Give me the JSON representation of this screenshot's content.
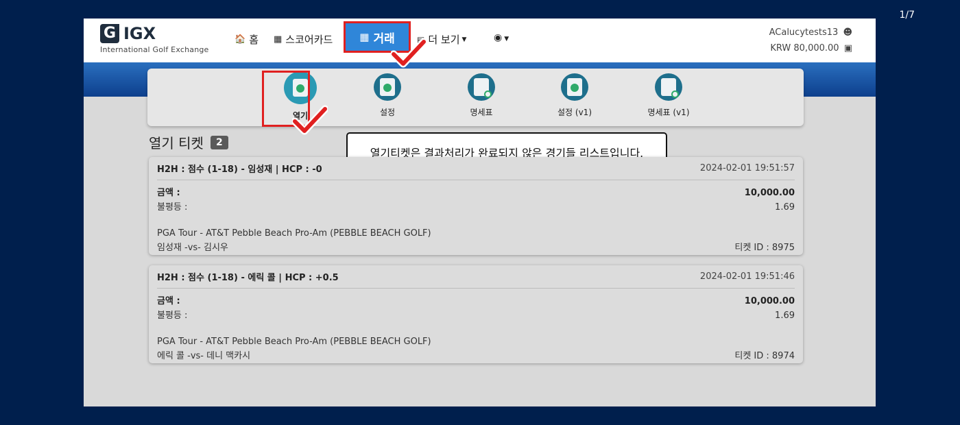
{
  "page_counter": "1/7",
  "brand": {
    "name": "IGX",
    "mark": "G",
    "subtitle": "International Golf Exchange"
  },
  "nav": {
    "home": "홈",
    "scorecard": "스코어카드",
    "trade": "거래",
    "more": "더 보기"
  },
  "user": {
    "name": "ACalucytests13",
    "balance": "KRW 80,000.00"
  },
  "tabs": [
    {
      "label": "열기"
    },
    {
      "label": "설정"
    },
    {
      "label": "명세표"
    },
    {
      "label": "설정 (v1)"
    },
    {
      "label": "명세표 (v1)"
    }
  ],
  "section": {
    "title": "열기 티켓",
    "count": "2"
  },
  "tooltip": "열기티켓은 결과처리가 완료되지 않은 경기들 리스트입니다.",
  "tickets": [
    {
      "title": "H2H : 점수 (1-18) - 임성재 | HCP : -0",
      "datetime": "2024-02-01 19:51:57",
      "amount_label": "금액 :",
      "amount": "10,000.00",
      "odds_label": "불평등 :",
      "odds": "1.69",
      "tournament": "PGA Tour - AT&T Pebble Beach Pro-Am (PEBBLE BEACH GOLF)",
      "matchup": "임성재 -vs- 김시우",
      "ticket_id": "티켓 ID : 8975"
    },
    {
      "title": "H2H : 점수 (1-18) - 에릭 콜 | HCP : +0.5",
      "datetime": "2024-02-01 19:51:46",
      "amount_label": "금액 :",
      "amount": "10,000.00",
      "odds_label": "불평등 :",
      "odds": "1.69",
      "tournament": "PGA Tour - AT&T Pebble Beach Pro-Am (PEBBLE BEACH GOLF)",
      "matchup": "에릭 콜 -vs- 데니 맥카시",
      "ticket_id": "티켓 ID : 8974"
    }
  ],
  "colors": {
    "accent": "#2f86d9",
    "highlight": "#e02020",
    "background": "#001f4d"
  }
}
